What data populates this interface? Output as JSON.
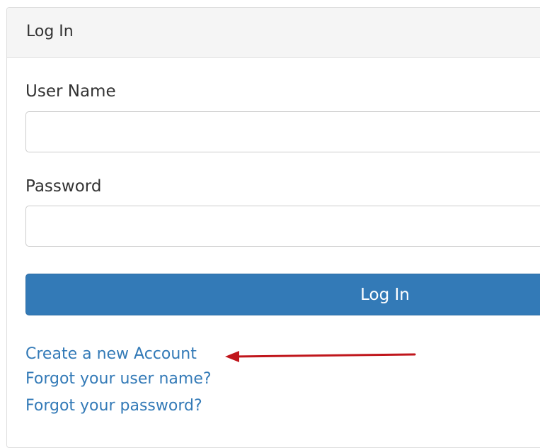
{
  "panel": {
    "title": "Log In"
  },
  "form": {
    "username_label": "User Name",
    "username_value": "",
    "password_label": "Password",
    "password_value": "",
    "submit_label": "Log In"
  },
  "links": {
    "create_account": "Create a new Account",
    "forgot_username": "Forgot your user name?",
    "forgot_password": "Forgot your password?"
  },
  "annotation": {
    "arrow_color": "#c0161c",
    "points_to": "create-account-link"
  }
}
